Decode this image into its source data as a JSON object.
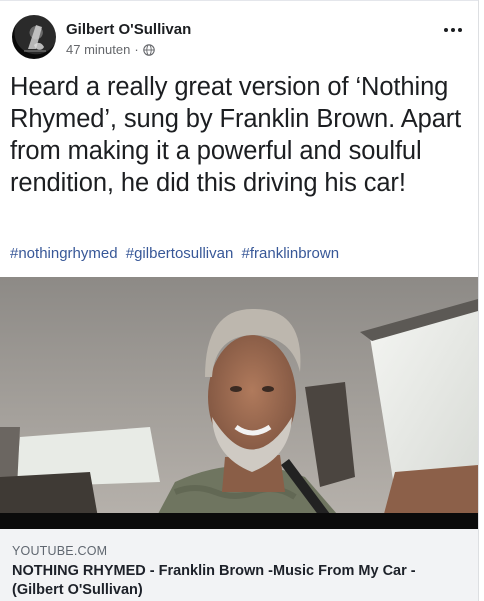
{
  "post": {
    "author": "Gilbert O'Sullivan",
    "timestamp": "47 minuten",
    "separator": "·",
    "privacy_icon": "globe-icon",
    "menu_icon": "more-horizontal-icon",
    "text": "Heard a really great version of ‘Nothing Rhymed’, sung by Franklin Brown. Apart from making it a powerful and soulful rendition, he did this driving his car!",
    "hashtags": [
      "#nothingrhymed",
      "#gilbertosullivan",
      "#franklinbrown"
    ]
  },
  "link_preview": {
    "domain": "YOUTUBE.COM",
    "title": "NOTHING RHYMED - Franklin Brown -Music From My Car - (Gilbert O'Sullivan)"
  },
  "colors": {
    "hashtag": "#385898",
    "meta_text": "#65676b",
    "preview_bg": "#f2f3f5"
  }
}
